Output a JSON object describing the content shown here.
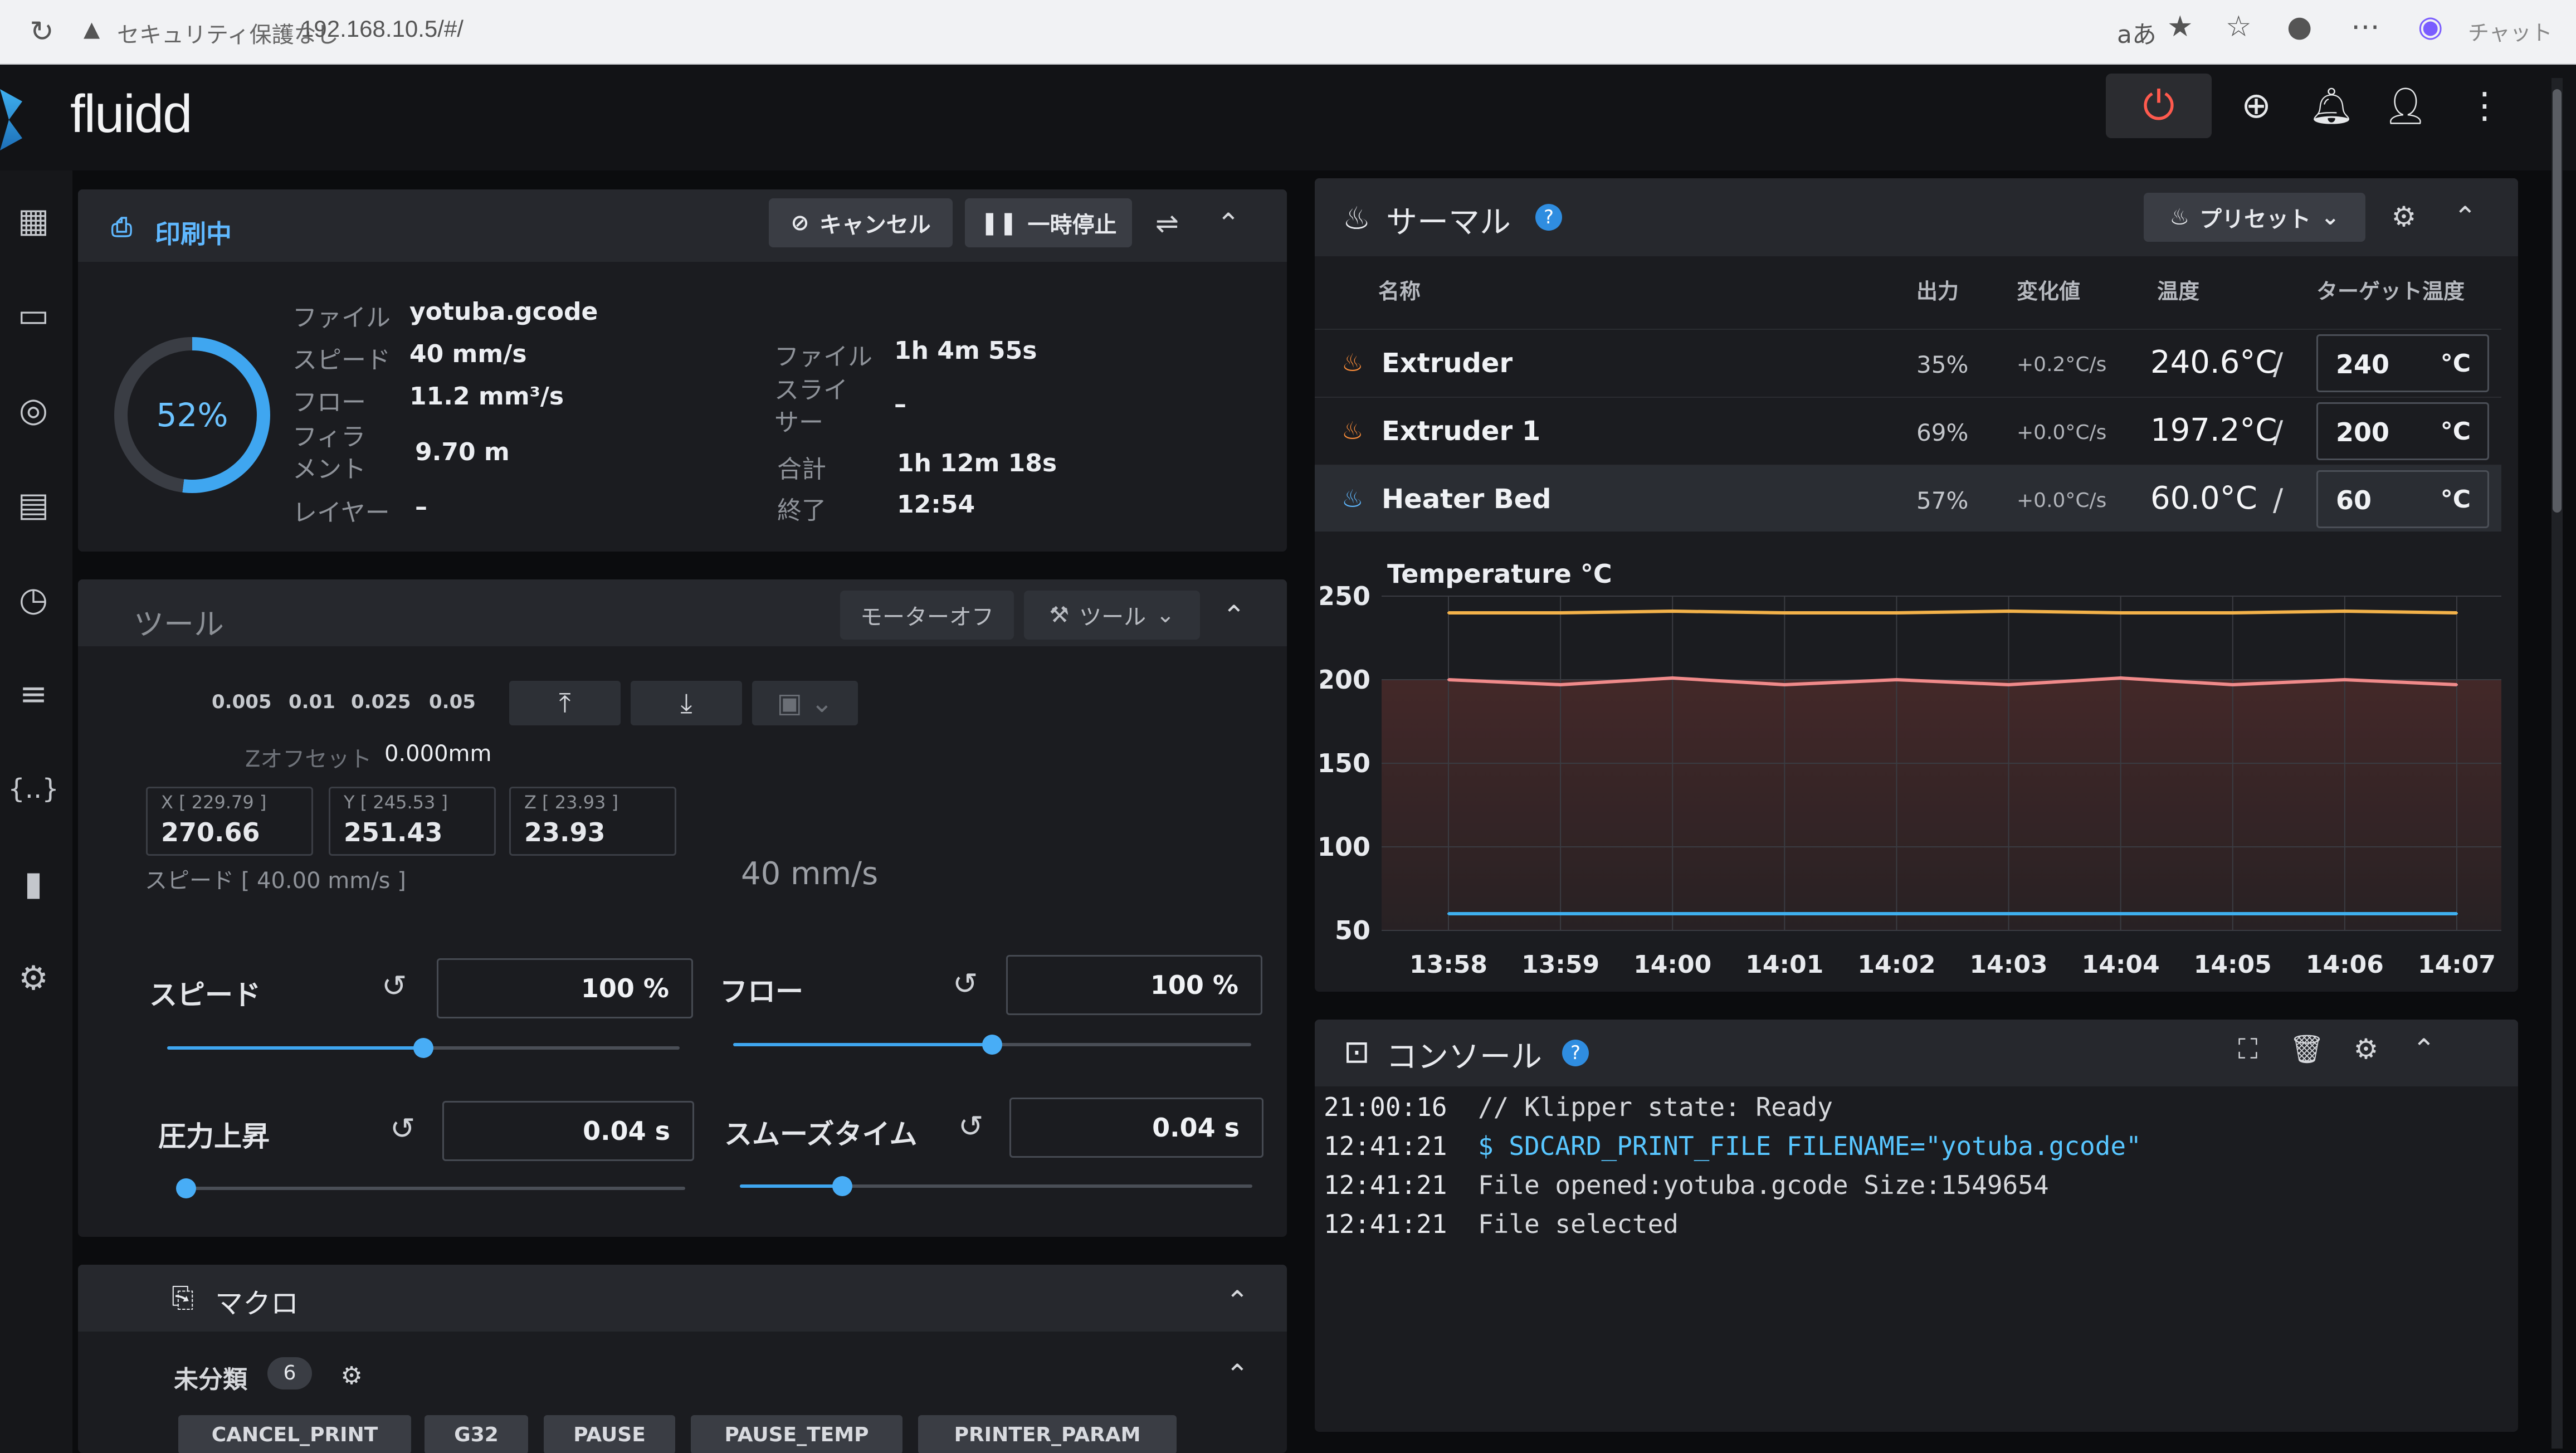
{
  "browser": {
    "security_label": "セキュリティ保護なし",
    "url": "192.168.10.5/#/",
    "chat_label": "チャット"
  },
  "app": {
    "name": "fluidd"
  },
  "status": {
    "title": "印刷中",
    "cancel_label": "キャンセル",
    "pause_label": "一時停止",
    "progress_text": "52%",
    "progress_value": 0.52,
    "left": [
      {
        "label": "ファイル",
        "value": "yotuba.gcode"
      },
      {
        "label": "スピード",
        "value": "40 mm/s"
      },
      {
        "label": "フロー",
        "value": "11.2 mm³/s"
      },
      {
        "label": "フィラメント",
        "value": "9.70 m"
      },
      {
        "label": "レイヤー",
        "value": "–"
      }
    ],
    "right": [
      {
        "label": "ファイル",
        "value": "1h 4m 55s"
      },
      {
        "label": "スライサー",
        "value": "–"
      },
      {
        "label": "合計",
        "value": "1h 12m 18s"
      },
      {
        "label": "終了",
        "value": "12:54"
      }
    ]
  },
  "tool": {
    "title": "ツール",
    "motors_off_label": "モーターオフ",
    "tools_label": "ツール",
    "steps": [
      "0.005",
      "0.01",
      "0.025",
      "0.05"
    ],
    "z_offset_label": "Zオフセット",
    "z_offset_value": "0.000mm",
    "axes": [
      {
        "label": "X [ 229.79 ]",
        "value": "270.66"
      },
      {
        "label": "Y [ 245.53 ]",
        "value": "251.43"
      },
      {
        "label": "Z [ 23.93 ]",
        "value": "23.93"
      }
    ],
    "speed_caption": "スピード [ 40.00 mm/s ]",
    "speed_overlay": "40 mm/s",
    "sliders": [
      {
        "label": "スピード",
        "value": "100 %",
        "level": 0.5
      },
      {
        "label": "フロー",
        "value": "100 %",
        "level": 0.5
      },
      {
        "label": "圧力上昇",
        "value": "0.04 s",
        "level": 0.0
      },
      {
        "label": "スムーズタイム",
        "value": "0.04 s",
        "level": 0.2
      }
    ]
  },
  "macros": {
    "title": "マクロ",
    "group_label": "未分類",
    "group_count": "6",
    "items": [
      "CANCEL_PRINT",
      "G32",
      "PAUSE",
      "PAUSE_TEMP",
      "PRINTER_PARAM"
    ]
  },
  "thermal": {
    "title": "サーマル",
    "presets_label": "プリセット",
    "headers": {
      "name": "名称",
      "power": "出力",
      "rate": "変化値",
      "temp": "温度",
      "target": "ターゲット温度"
    },
    "rows": [
      {
        "name": "Extruder",
        "power": "35%",
        "rate": "+0.2°C/s",
        "temp": "240.6°C",
        "target": "240",
        "unit": "°C"
      },
      {
        "name": "Extruder 1",
        "power": "69%",
        "rate": "+0.0°C/s",
        "temp": "197.2°C",
        "target": "200",
        "unit": "°C"
      },
      {
        "name": "Heater Bed",
        "power": "57%",
        "rate": "+0.0°C/s",
        "temp": "60.0°C",
        "target": "60",
        "unit": "°C"
      }
    ],
    "separator": "/"
  },
  "chart_data": {
    "type": "line",
    "title": "Temperature °C",
    "ylim": [
      50,
      250
    ],
    "yticks": [
      "250",
      "200",
      "150",
      "100",
      "50"
    ],
    "x": [
      "13:58",
      "13:59",
      "14:00",
      "14:01",
      "14:02",
      "14:03",
      "14:04",
      "14:05",
      "14:06",
      "14:07"
    ],
    "series": [
      {
        "values": [
          240,
          240,
          241,
          240,
          240,
          241,
          240,
          240,
          241,
          240
        ],
        "color": "#f3b24a"
      },
      {
        "values": [
          200,
          197,
          201,
          197,
          200,
          197,
          201,
          197,
          200,
          197
        ],
        "color": "#f08a8a"
      },
      {
        "values": [
          60,
          60,
          60,
          60,
          60,
          60,
          60,
          60,
          60,
          60
        ],
        "color": "#3fb0ef"
      }
    ]
  },
  "console": {
    "title": "コンソール",
    "lines": [
      {
        "time": "21:00:16",
        "msg": "// Klipper state: Ready",
        "kind": "info"
      },
      {
        "time": "12:41:21",
        "msg": "$ SDCARD_PRINT_FILE FILENAME=\"yotuba.gcode\"",
        "kind": "cmd"
      },
      {
        "time": "12:41:21",
        "msg": "File opened:yotuba.gcode Size:1549654",
        "kind": "info"
      },
      {
        "time": "12:41:21",
        "msg": "File selected",
        "kind": "info"
      }
    ]
  }
}
